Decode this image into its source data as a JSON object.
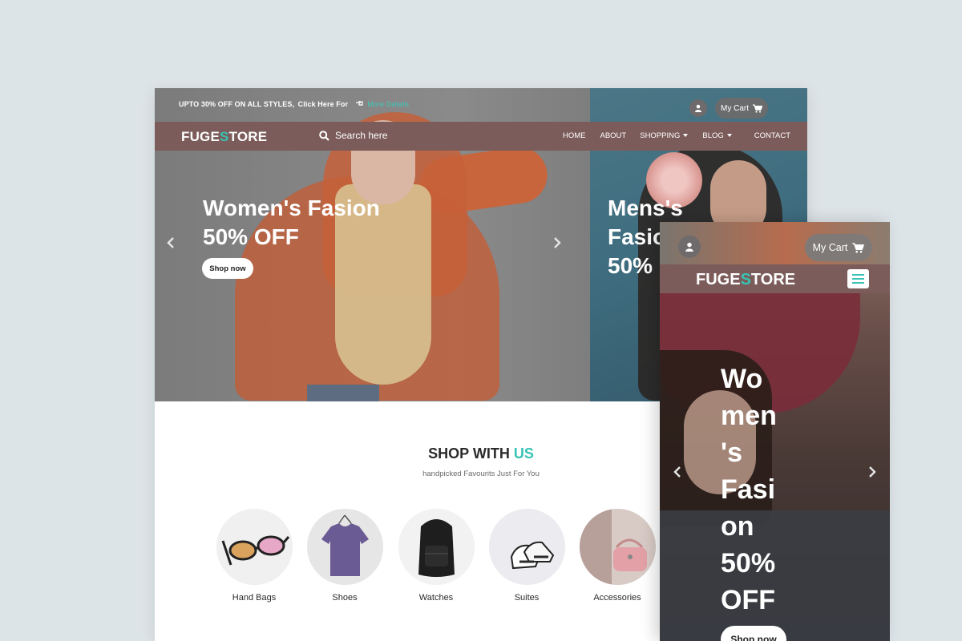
{
  "desktop": {
    "topbar": {
      "promo_text": "UPTO 30% OFF ON ALL STYLES,",
      "click_text": "Click Here For",
      "more_details": "More Details",
      "cart_label": "My Cart"
    },
    "navbar": {
      "logo_pre": "FUGE",
      "logo_accent": "S",
      "logo_post": "TORE",
      "search_placeholder": "Search here",
      "links": [
        "HOME",
        "ABOUT",
        "SHOPPING",
        "BLOG",
        "CONTACT"
      ]
    },
    "hero": {
      "slide1_line1": "Women's Fasion",
      "slide1_line2": "50% OFF",
      "slide1_button": "Shop now",
      "slide2_line1": "Mens's",
      "slide2_line2": "Fasio",
      "slide2_line3": "50%"
    },
    "shop": {
      "title_pre": "SHOP WITH ",
      "title_accent": "US",
      "subtitle": "handpicked Favourits Just For You",
      "categories": [
        "Hand Bags",
        "Shoes",
        "Watches",
        "Suites",
        "Accessories"
      ]
    }
  },
  "mobile": {
    "cart_label": "My Cart",
    "logo_pre": "FUGE",
    "logo_accent": "S",
    "logo_post": "TORE",
    "hero_title": "Wo\nmen\n's\nFasi\non\n50%\nOFF",
    "hero_button": "Shop now"
  },
  "colors": {
    "accent": "#38c3b4",
    "navbar": "#7b5c5a",
    "background": "#dde4e8"
  },
  "icons": [
    "user-icon",
    "cart-icon",
    "search-icon",
    "hand-pointer-icon",
    "chevron-left-icon",
    "chevron-right-icon",
    "hamburger-menu-icon"
  ]
}
